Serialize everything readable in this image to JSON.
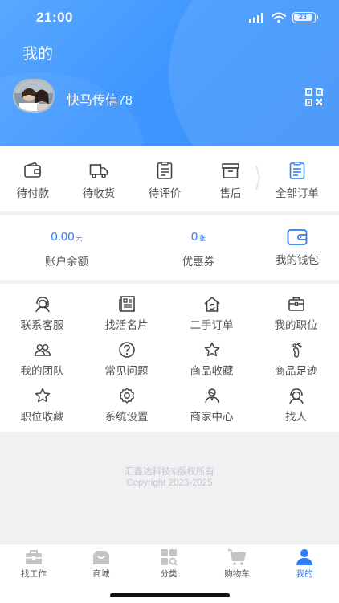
{
  "status_bar": {
    "time": "21:00",
    "battery": "23"
  },
  "header": {
    "title": "我的",
    "username": "快马传信78"
  },
  "orders": [
    {
      "label": "待付款",
      "icon": "wallet-icon"
    },
    {
      "label": "待收货",
      "icon": "truck-icon"
    },
    {
      "label": "待评价",
      "icon": "clipboard-icon"
    },
    {
      "label": "售后",
      "icon": "archive-box-icon"
    },
    {
      "label": "全部订单",
      "icon": "order-list-icon"
    }
  ],
  "wallet": {
    "balance_value": "0.00",
    "balance_unit": "元",
    "balance_label": "账户余额",
    "coupon_value": "0",
    "coupon_unit": "张",
    "coupon_label": "优惠券",
    "wallet_label": "我的钱包"
  },
  "services": [
    {
      "label": "联系客服",
      "icon": "customer-service-icon"
    },
    {
      "label": "找活名片",
      "icon": "newspaper-icon"
    },
    {
      "label": "二手订单",
      "icon": "house-refresh-icon"
    },
    {
      "label": "我的职位",
      "icon": "briefcase-icon"
    },
    {
      "label": "我的团队",
      "icon": "team-icon"
    },
    {
      "label": "常见问题",
      "icon": "question-icon"
    },
    {
      "label": "商品收藏",
      "icon": "star-icon"
    },
    {
      "label": "商品足迹",
      "icon": "footprint-icon"
    },
    {
      "label": "职位收藏",
      "icon": "star-icon"
    },
    {
      "label": "系统设置",
      "icon": "settings-icon"
    },
    {
      "label": "商家中心",
      "icon": "merchant-icon"
    },
    {
      "label": "找人",
      "icon": "find-person-icon"
    }
  ],
  "footer": {
    "company": "汇鑫达科技©版权所有",
    "copyright": "Copyright 2023-2025"
  },
  "tabs": [
    {
      "label": "找工作",
      "icon": "briefcase-icon"
    },
    {
      "label": "商城",
      "icon": "shop-icon"
    },
    {
      "label": "分类",
      "icon": "category-grid-icon"
    },
    {
      "label": "购物车",
      "icon": "cart-icon"
    },
    {
      "label": "我的",
      "icon": "person-icon",
      "active": true
    }
  ],
  "colors": {
    "header_blue": "#3f97ff",
    "accent_blue": "#2f7cf6",
    "tab_inactive": "#c4c4c4"
  }
}
